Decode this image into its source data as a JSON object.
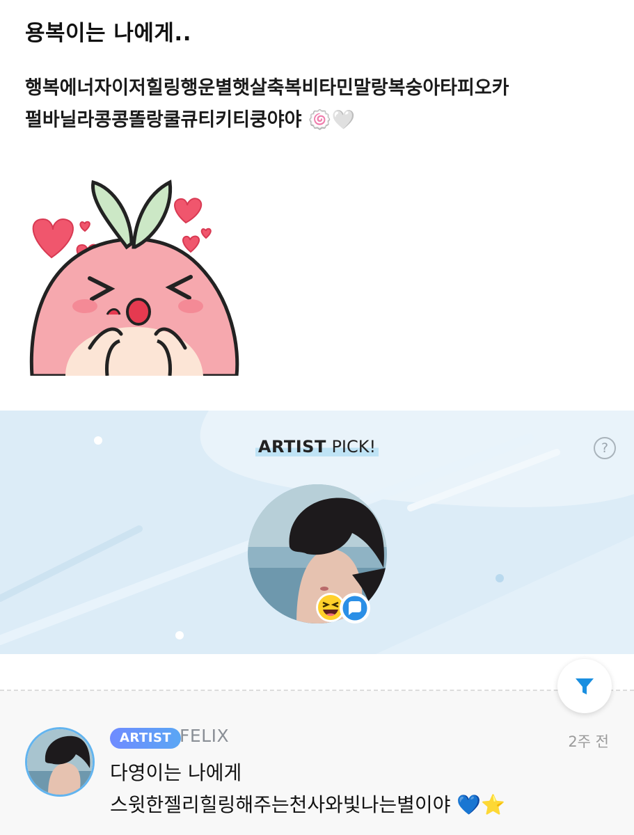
{
  "post": {
    "title": "용복이는 나에게..",
    "body_line1": "행복에너자이저힐링행운별햇살축복비타민말랑복숭아타피오카",
    "body_line2": "펄바닐라콩콩똘랑쿨큐티키티쿵야야 🍥🤍"
  },
  "sticker": {
    "name": "peach-character-sticker"
  },
  "artist_pick": {
    "title_bold": "ARTIST",
    "title_rest": " PICK!",
    "help_label": "?",
    "avatar_badges": [
      "laughing-emoji",
      "chat-bubble-icon"
    ]
  },
  "comment": {
    "badge": "ARTIST",
    "author": "FELIX",
    "time": "2주 전",
    "line1": "다영이는 나에게",
    "line2": "스윗한젤리힐링해주는천사와빛나는별이야 💙⭐"
  },
  "colors": {
    "pick_bg": "#dcecf7",
    "accent_blue": "#1a8fe0",
    "badge_gradient_start": "#6f8bff",
    "badge_gradient_end": "#5aa6f4"
  }
}
